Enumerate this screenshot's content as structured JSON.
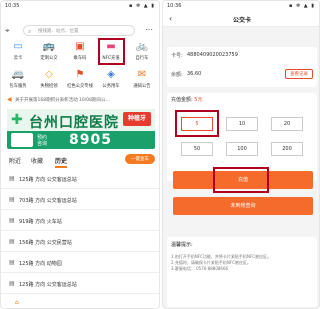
{
  "left": {
    "status": {
      "time": "10:35",
      "icons": "▪ ✻ ▲ ▮"
    },
    "search_placeholder": "搜线路、站点、位置",
    "grid": [
      {
        "label": "云卡",
        "icon": "▭"
      },
      {
        "label": "定制公交",
        "icon": "🚌"
      },
      {
        "label": "乘车码",
        "icon": "▣"
      },
      {
        "label": "NFC充值",
        "icon": "▬"
      },
      {
        "label": "自行车",
        "icon": "🚲"
      },
      {
        "label": "包车服务",
        "icon": "🚐"
      },
      {
        "label": "失物招领",
        "icon": "◇"
      },
      {
        "label": "红色公交专线",
        "icon": "⚑"
      },
      {
        "label": "公务用车",
        "icon": "◈"
      },
      {
        "label": "通知公告",
        "icon": "✉"
      }
    ],
    "notice": "关于开展第168期积分表彰活动 10/08期间公...",
    "banner": {
      "name": "台州口腔医院",
      "tag": "种植牙",
      "sub": "预约\n咨询",
      "phone": "8905 7777"
    },
    "tabs": {
      "nearby": "附近",
      "fav": "收藏",
      "history": "历史",
      "button": "一键查车"
    },
    "history": [
      "125路 方向 公交客运总站",
      "703路 方向 公交客运总站",
      "919路 方向 火车站",
      "156路 方向 公交民营站",
      "125路 方向 动物园",
      "125路 方向 公交客运总站"
    ]
  },
  "right": {
    "status": {
      "time": "10:36",
      "icons": "▪ ✻ ▲ ▮"
    },
    "title": "公交卡",
    "card_label": "卡号:",
    "card_no": "4880409020023759",
    "balance_label": "余额:",
    "balance": "36.60",
    "record_button": "查看记录",
    "amount_label": "充值金额:",
    "amount_value": "5元",
    "options": [
      "5",
      "10",
      "20",
      "50",
      "100",
      "200"
    ],
    "recharge_button": "充值",
    "query_button": "未到账查询",
    "tips_title": "温馨提示:",
    "tips": [
      "1.由打开手机NFC功能，并将卡片紧贴手机NFC感应区。",
      "2.充值时，请确保卡片紧贴手机NFC感应区。",
      "3.客服电话： 0576-88808666"
    ]
  }
}
